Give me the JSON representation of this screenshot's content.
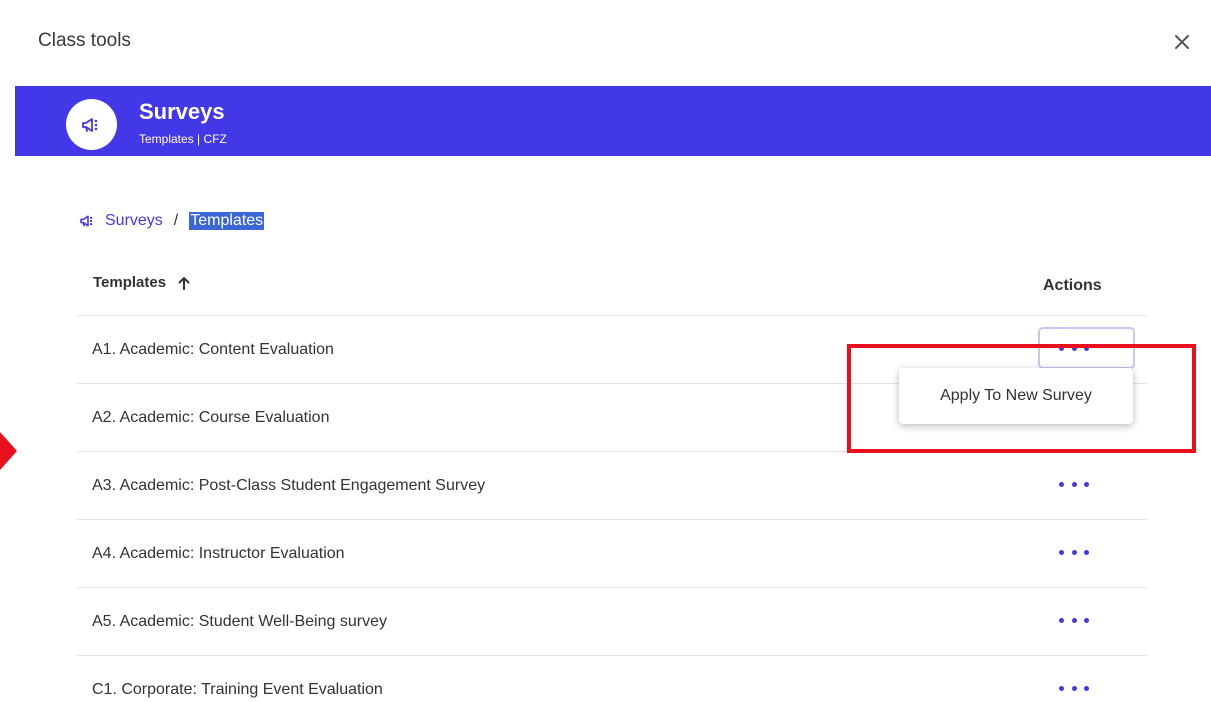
{
  "dialog": {
    "title": "Class tools"
  },
  "banner": {
    "title": "Surveys",
    "subtitle": "Templates | CFZ",
    "background": "#4338e8"
  },
  "breadcrumb": {
    "link": "Surveys",
    "separator": "/",
    "current": "Templates"
  },
  "table": {
    "header_templates": "Templates",
    "header_actions": "Actions",
    "rows": [
      {
        "label": "A1. Academic: Content Evaluation"
      },
      {
        "label": "A2. Academic: Course Evaluation"
      },
      {
        "label": "A3. Academic: Post-Class Student Engagement Survey"
      },
      {
        "label": "A4. Academic: Instructor Evaluation"
      },
      {
        "label": "A5. Academic: Student Well-Being survey"
      },
      {
        "label": "C1. Corporate: Training Event Evaluation"
      }
    ]
  },
  "menu": {
    "items": [
      {
        "label": "Apply To New Survey"
      }
    ]
  },
  "colors": {
    "accent": "#4338e8",
    "annotation": "#e8101c",
    "selection": "#3b67d4"
  },
  "icons": {
    "close": "close-icon",
    "megaphone": "megaphone-icon",
    "sort": "arrow-up-icon",
    "more": "more-horizontal-icon"
  }
}
